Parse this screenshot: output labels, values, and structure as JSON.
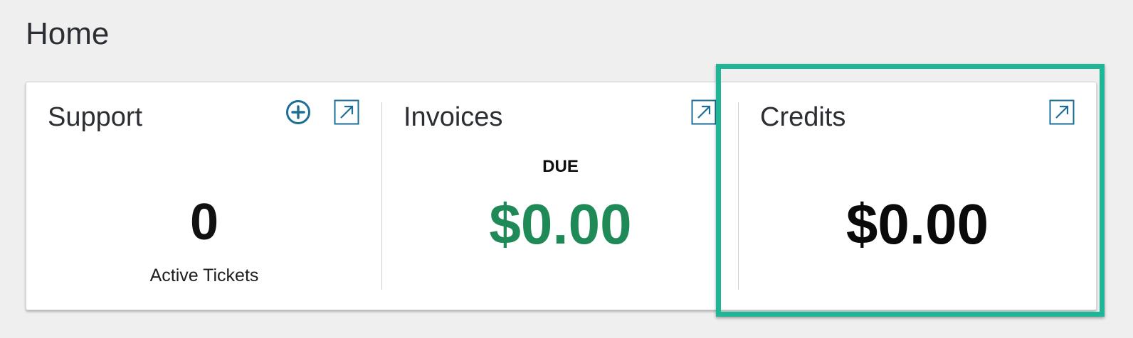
{
  "page": {
    "title": "Home"
  },
  "support": {
    "title": "Support",
    "count": "0",
    "caption": "Active Tickets",
    "icons": {
      "add": "plus-circle-icon",
      "open": "external-link-icon"
    }
  },
  "invoices": {
    "title": "Invoices",
    "due_label": "DUE",
    "amount": "$0.00",
    "icons": {
      "open": "external-link-icon"
    }
  },
  "credits": {
    "title": "Credits",
    "amount": "$0.00",
    "icons": {
      "open": "external-link-icon"
    }
  },
  "colors": {
    "background": "#efefef",
    "icon": "#1e6d96",
    "invoice_amount": "#1f8a57",
    "highlight": "#1fb597"
  }
}
